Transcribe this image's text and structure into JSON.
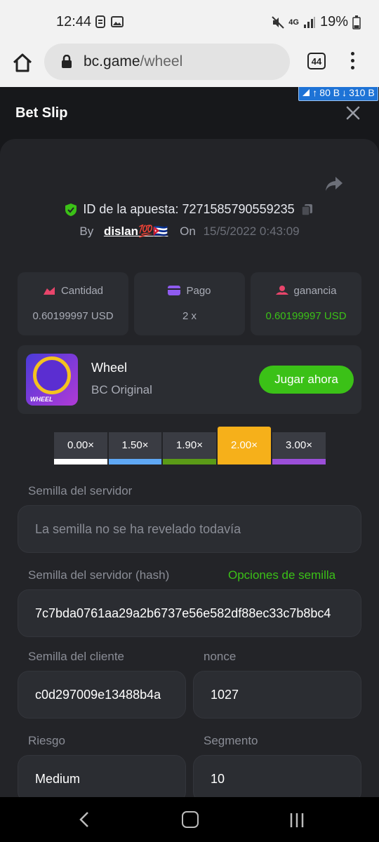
{
  "status_bar": {
    "time": "12:44",
    "network": "4G",
    "battery": "19%"
  },
  "browser": {
    "domain": "bc.game",
    "path": "/wheel",
    "tab_count": "44"
  },
  "net_badge": {
    "up": "80 B",
    "down": "310 B"
  },
  "bet_slip": {
    "title": "Bet Slip",
    "bet_id": "ID de la apuesta: 7271585790559235",
    "by_label": "By",
    "user": "dislan💯🇨🇺",
    "on_label": "On",
    "date": "15/5/2022 0:43:09",
    "stats": [
      {
        "label": "Cantidad",
        "value": "0.60199997 USD"
      },
      {
        "label": "Pago",
        "value": "2 x"
      },
      {
        "label": "ganancia",
        "value": "0.60199997 USD"
      }
    ],
    "game": {
      "name": "Wheel",
      "provider": "BC Original",
      "play_label": "Jugar ahora",
      "thumb_text": "WHEEL"
    },
    "multipliers": [
      {
        "label": "0.00×",
        "color": "#ffffff"
      },
      {
        "label": "1.50×",
        "color": "#5fa8f5"
      },
      {
        "label": "1.90×",
        "color": "#5b9b17"
      },
      {
        "label": "2.00×",
        "color": "#f6b01a"
      },
      {
        "label": "3.00×",
        "color": "#9b4fd9"
      }
    ],
    "selected_multiplier": "2.00×",
    "server_seed": {
      "label": "Semilla del servidor",
      "placeholder": "La semilla no se ha revelado todavía"
    },
    "server_hash": {
      "label": "Semilla del servidor (hash)",
      "link": "Opciones de semilla",
      "value": "7c7bda0761aa29a2b6737e56e582df88ec33c7b8bc4"
    },
    "client_seed": {
      "label": "Semilla del cliente",
      "value": "c0d297009e13488b4a"
    },
    "nonce": {
      "label": "nonce",
      "value": "1027"
    },
    "risk": {
      "label": "Riesgo",
      "value": "Medium"
    },
    "segment": {
      "label": "Segmento",
      "value": "10"
    }
  },
  "colors": {
    "accent_green": "#3bc117",
    "background": "#17181b",
    "card": "#232428"
  }
}
